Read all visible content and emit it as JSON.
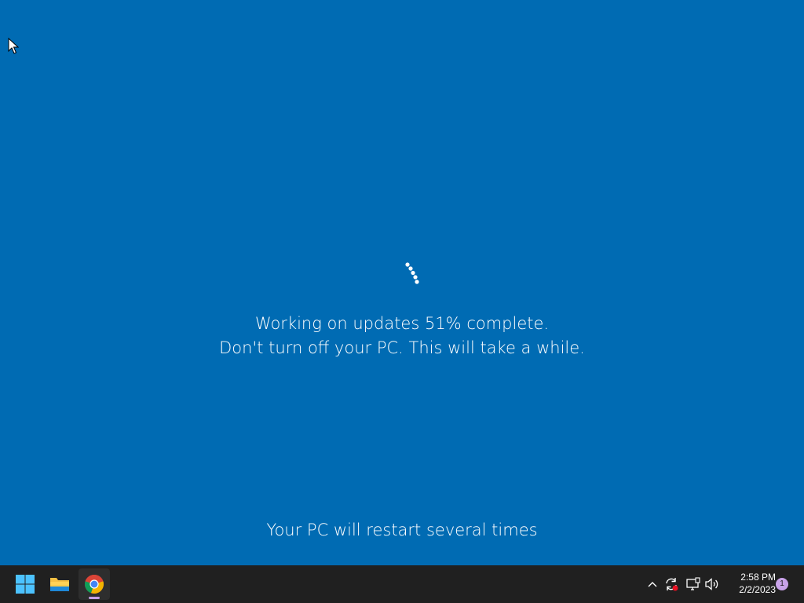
{
  "screen": {
    "background_color": "#006bb3",
    "update_status_line": "Working on updates  51% complete.",
    "warning_line": "Don't turn off your PC. This will take a while.",
    "progress_percent": 51,
    "restart_note": "Your PC will restart several times"
  },
  "cursor": {
    "icon": "arrow-cursor-icon"
  },
  "spinner": {
    "icon": "loading-dots-spinner-icon"
  },
  "taskbar": {
    "background_color": "#202020",
    "pinned_apps": [
      {
        "name": "Start",
        "icon": "windows-start-icon"
      },
      {
        "name": "File Explorer",
        "icon": "folder-icon"
      },
      {
        "name": "Google Chrome",
        "icon": "chrome-icon",
        "active": true
      }
    ],
    "tray": {
      "icons": [
        "chevron-up-icon",
        "sync-alert-icon",
        "network-icon",
        "volume-icon"
      ],
      "time": "2:58 PM",
      "date": "2/2/2023",
      "notification_count": "1",
      "notification_color": "#c8a2e8"
    }
  }
}
